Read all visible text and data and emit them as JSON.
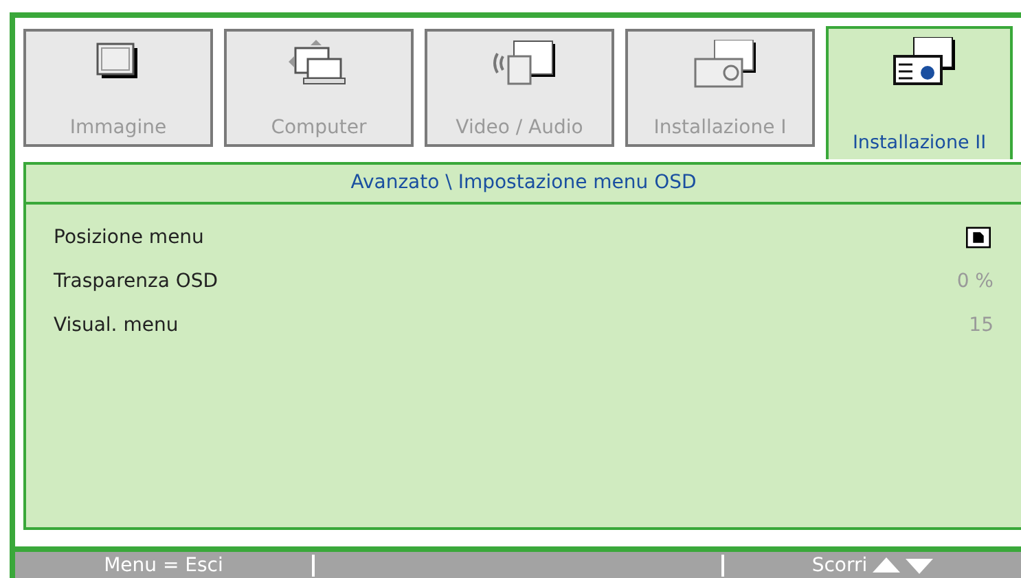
{
  "tabs": [
    {
      "label": "Immagine",
      "selected": false
    },
    {
      "label": "Computer",
      "selected": false
    },
    {
      "label": "Video / Audio",
      "selected": false
    },
    {
      "label": "Installazione I",
      "selected": false
    },
    {
      "label": "Installazione II",
      "selected": true
    }
  ],
  "breadcrumb": "Avanzato \\ Impostazione menu OSD",
  "rows": [
    {
      "kind": "icon",
      "label": "Posizione menu"
    },
    {
      "kind": "text",
      "label": "Trasparenza OSD",
      "value": "0 %"
    },
    {
      "kind": "text",
      "label": "Visual. menu",
      "value": "15"
    }
  ],
  "status_bar": {
    "left": "Menu = Esci",
    "right": "Scorri"
  }
}
